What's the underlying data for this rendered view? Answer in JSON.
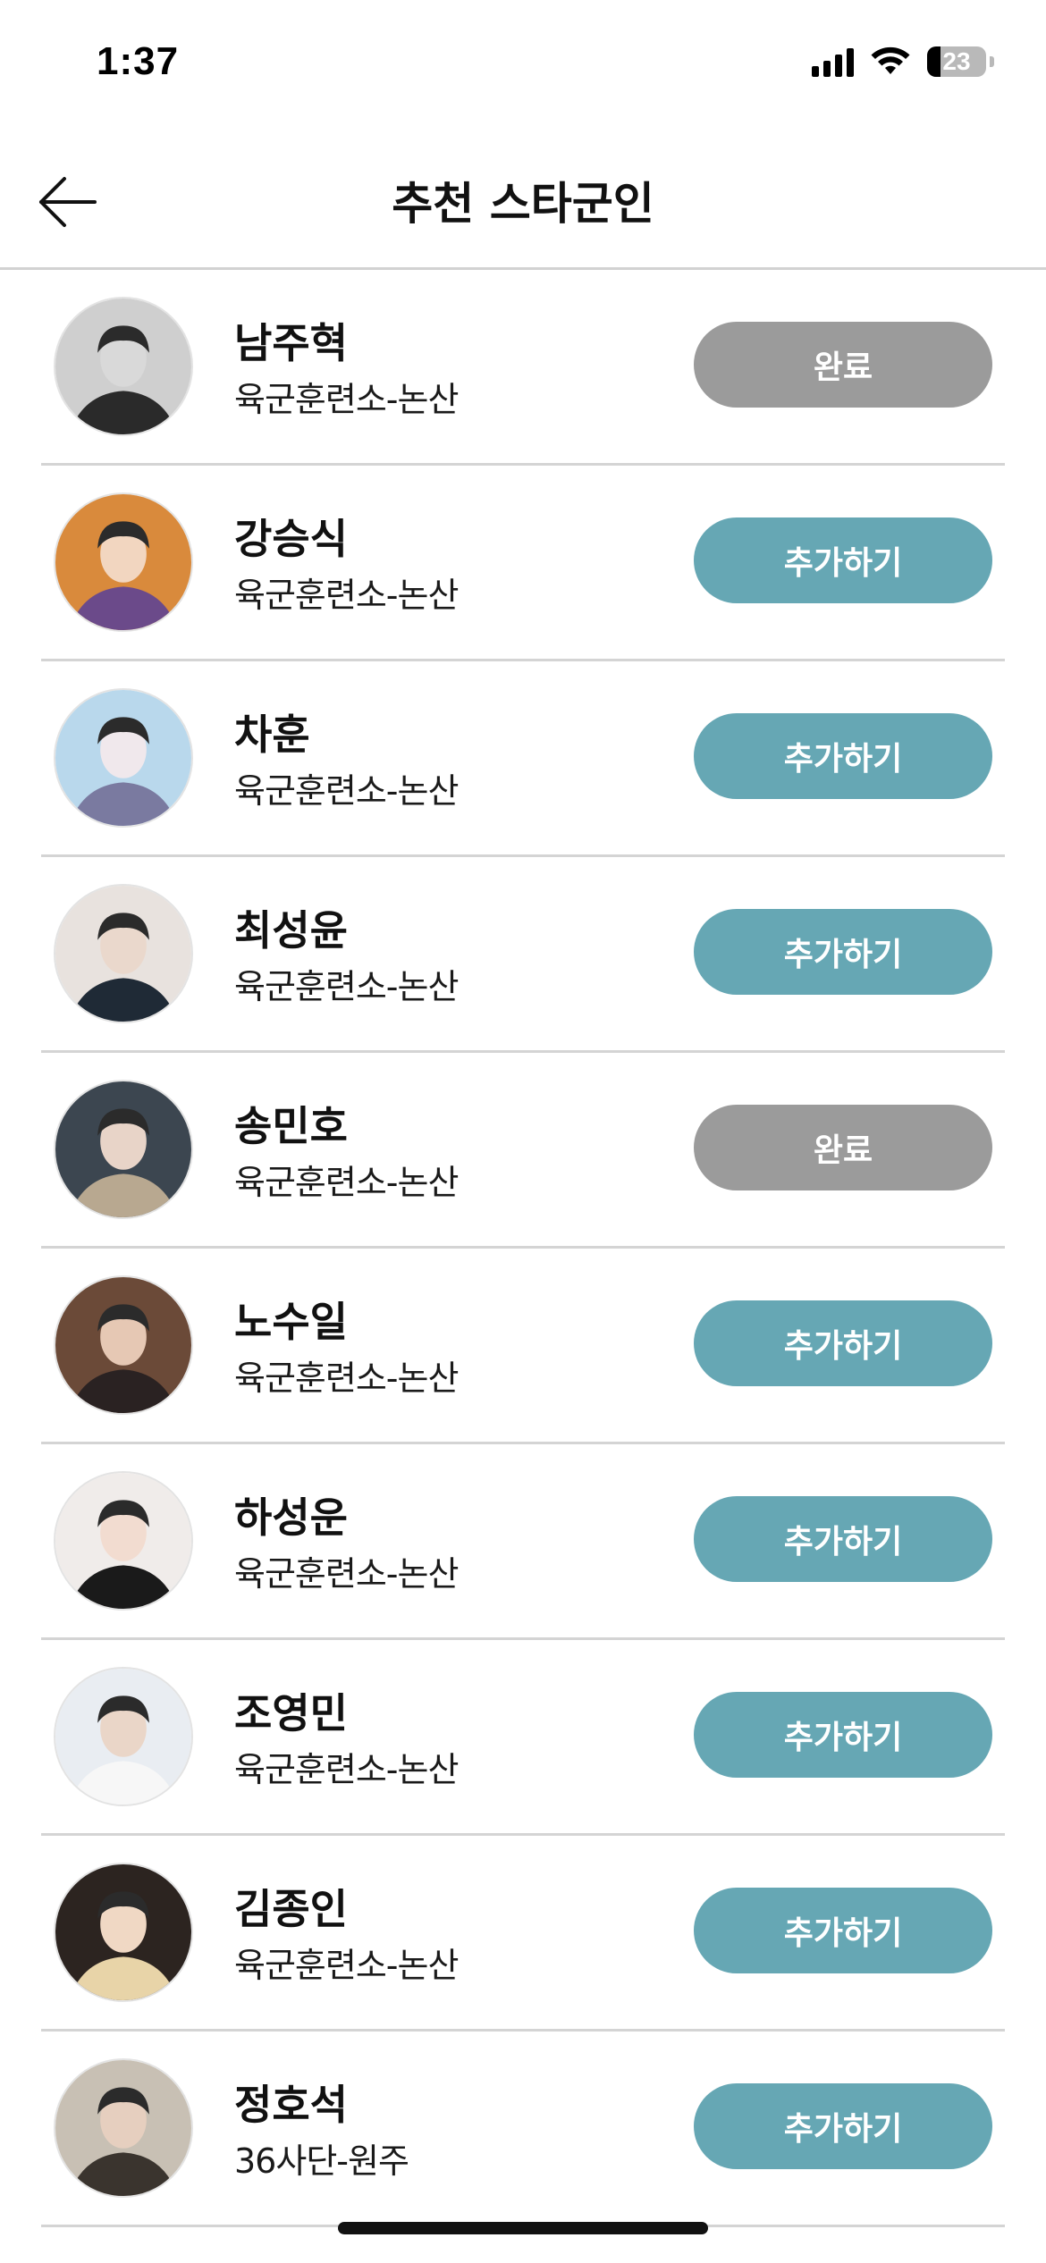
{
  "status_bar": {
    "time": "1:37",
    "battery": "23",
    "battery_level": 0.23
  },
  "header": {
    "title": "추천 스타군인",
    "back_icon": "arrow-left-icon"
  },
  "colors": {
    "done_button": "#9b9b9b",
    "add_button": "#66a7b4",
    "divider": "#d4d4d4"
  },
  "soldiers": [
    {
      "name": "남주혁",
      "unit": "육군훈련소-논산",
      "button": "완료",
      "state": "done"
    },
    {
      "name": "강승식",
      "unit": "육군훈련소-논산",
      "button": "추가하기",
      "state": "add"
    },
    {
      "name": "차훈",
      "unit": "육군훈련소-논산",
      "button": "추가하기",
      "state": "add"
    },
    {
      "name": "최성윤",
      "unit": "육군훈련소-논산",
      "button": "추가하기",
      "state": "add"
    },
    {
      "name": "송민호",
      "unit": "육군훈련소-논산",
      "button": "완료",
      "state": "done"
    },
    {
      "name": "노수일",
      "unit": "육군훈련소-논산",
      "button": "추가하기",
      "state": "add"
    },
    {
      "name": "하성운",
      "unit": "육군훈련소-논산",
      "button": "추가하기",
      "state": "add"
    },
    {
      "name": "조영민",
      "unit": "육군훈련소-논산",
      "button": "추가하기",
      "state": "add"
    },
    {
      "name": "김종인",
      "unit": "육군훈련소-논산",
      "button": "추가하기",
      "state": "add"
    },
    {
      "name": "정호석",
      "unit": "36사단-원주",
      "button": "추가하기",
      "state": "add"
    }
  ]
}
